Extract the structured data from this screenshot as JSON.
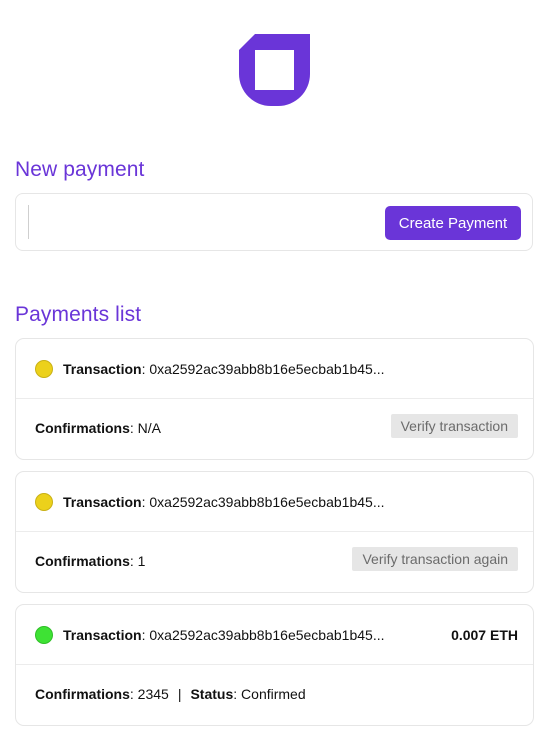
{
  "colors": {
    "brand": "#6a35d8",
    "pending": "#ecd11b",
    "confirmed": "#3ee234"
  },
  "logo": {
    "icon": "brand-logo-icon"
  },
  "new_payment": {
    "title": "New payment",
    "input_value": "",
    "input_placeholder": "",
    "button_label": "Create Payment"
  },
  "payments_list": {
    "title": "Payments list",
    "items": [
      {
        "status_indicator": "pending",
        "transaction_label": "Transaction",
        "transaction_hash": "0xa2592ac39abb8b16e5ecbab1b45...",
        "amount": "",
        "confirmations_label": "Confirmations",
        "confirmations_value": "N/A",
        "status_label": "",
        "status_value": "",
        "action_label": "Verify transaction"
      },
      {
        "status_indicator": "pending",
        "transaction_label": "Transaction",
        "transaction_hash": "0xa2592ac39abb8b16e5ecbab1b45...",
        "amount": "",
        "confirmations_label": "Confirmations",
        "confirmations_value": "1",
        "status_label": "",
        "status_value": "",
        "action_label": "Verify transaction again"
      },
      {
        "status_indicator": "confirmed",
        "transaction_label": "Transaction",
        "transaction_hash": "0xa2592ac39abb8b16e5ecbab1b45...",
        "amount": "0.007 ETH",
        "confirmations_label": "Confirmations",
        "confirmations_value": "2345",
        "separator": "|",
        "status_label": "Status",
        "status_value": "Confirmed",
        "action_label": ""
      }
    ]
  }
}
